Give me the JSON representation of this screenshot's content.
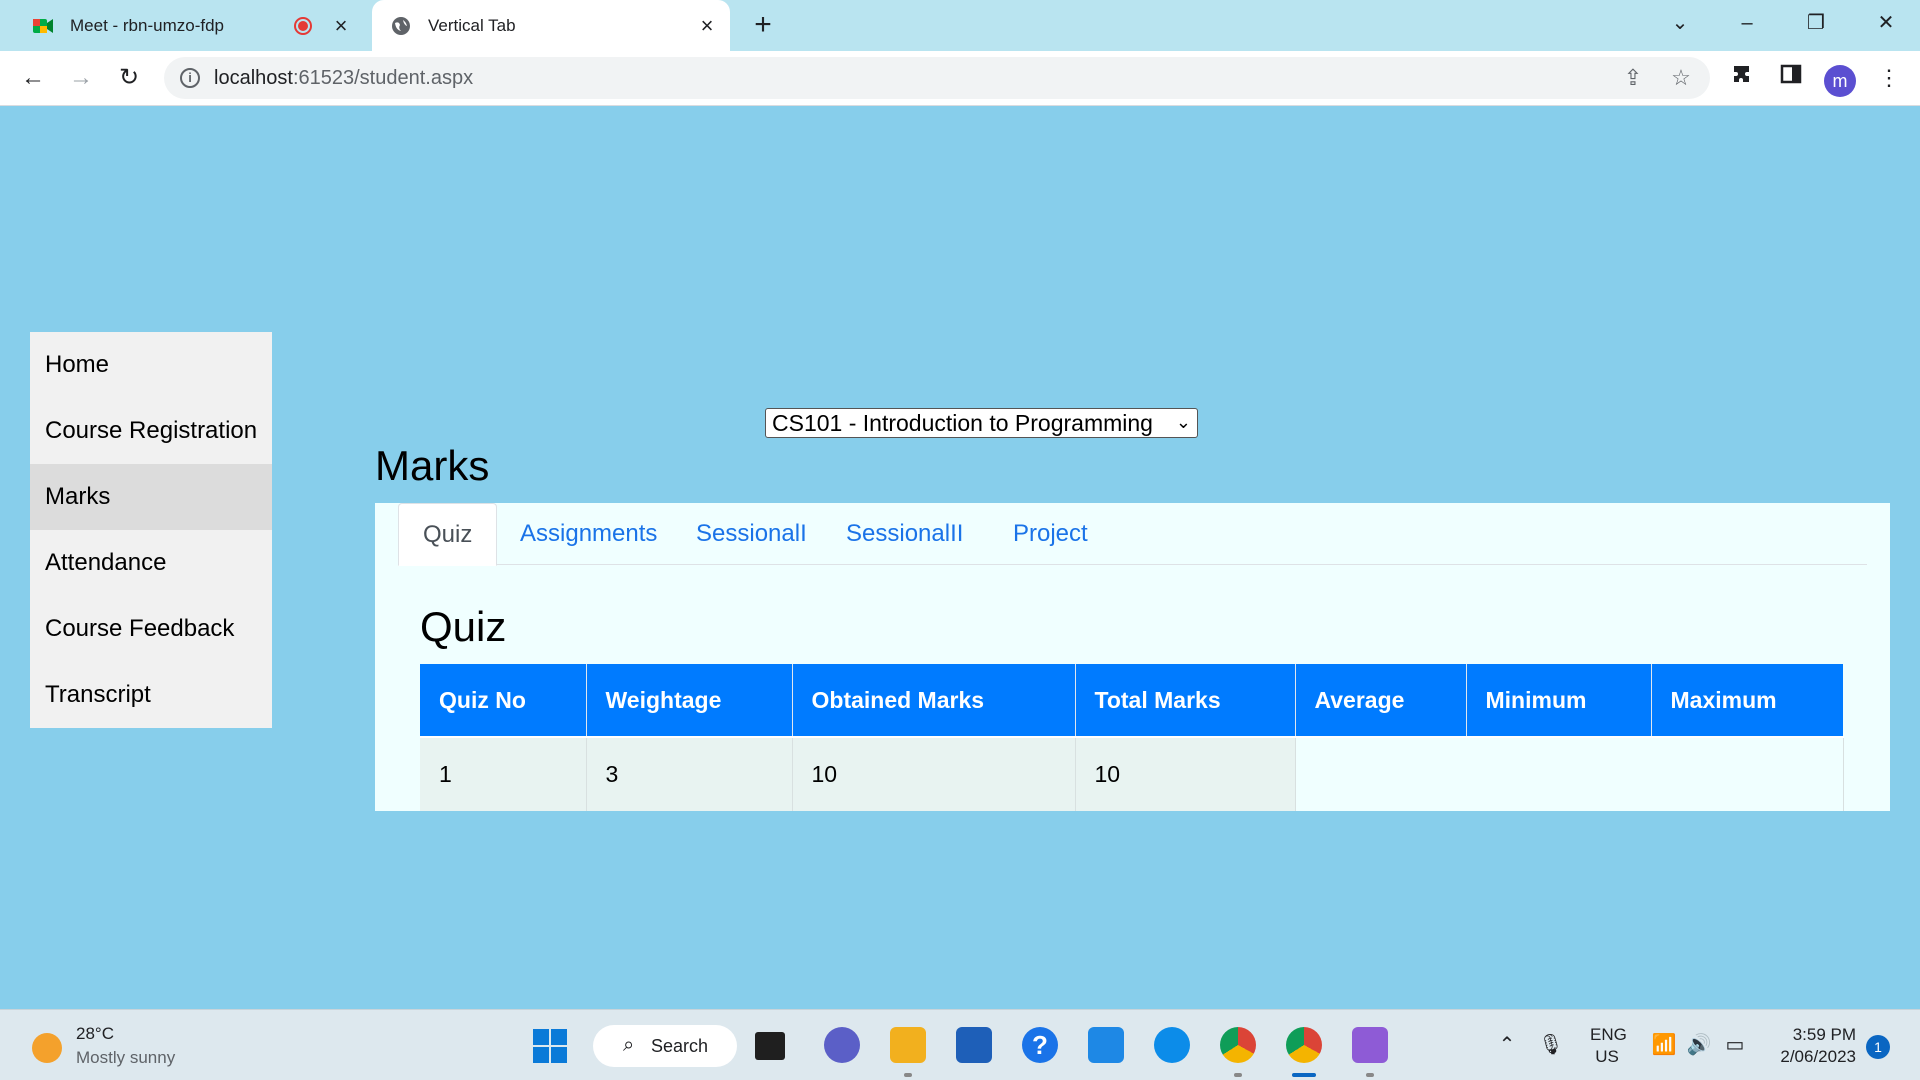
{
  "browser": {
    "tabs": [
      {
        "title": "Meet - rbn-umzo-fdp",
        "active": false
      },
      {
        "title": "Vertical Tab",
        "active": true
      }
    ],
    "new_tab_label": "+",
    "url_host": "localhost",
    "url_rest": ":61523/student.aspx",
    "profile_initial": "m"
  },
  "sidebar": {
    "items": [
      {
        "label": "Home"
      },
      {
        "label": "Course Registration"
      },
      {
        "label": "Marks"
      },
      {
        "label": "Attendance"
      },
      {
        "label": "Course Feedback"
      },
      {
        "label": "Transcript"
      }
    ],
    "active_index": 2
  },
  "course_select": {
    "selected": "CS101 - Introduction to Programming"
  },
  "page": {
    "title": "Marks"
  },
  "marks_tabs": {
    "items": [
      {
        "label": "Quiz"
      },
      {
        "label": "Assignments"
      },
      {
        "label": "SessionalI"
      },
      {
        "label": "SessionalII"
      },
      {
        "label": "Project"
      }
    ],
    "active_index": 0
  },
  "quiz": {
    "title": "Quiz",
    "columns": [
      "Quiz No",
      "Weightage",
      "Obtained Marks",
      "Total Marks",
      "Average",
      "Minimum",
      "Maximum"
    ],
    "rows": [
      [
        "1",
        "3",
        "10",
        "10",
        "",
        "",
        ""
      ]
    ]
  },
  "taskbar": {
    "weather_temp": "28°C",
    "weather_desc": "Mostly sunny",
    "search_label": "Search",
    "lang_line1": "ENG",
    "lang_line2": "US",
    "time": "3:59 PM",
    "date": "2/06/2023",
    "notifications": "1"
  },
  "colors": {
    "page_bg": "#87ceeb",
    "table_header": "#007bff",
    "tab_link": "#1a73e8",
    "panel_bg": "#f0ffff"
  }
}
